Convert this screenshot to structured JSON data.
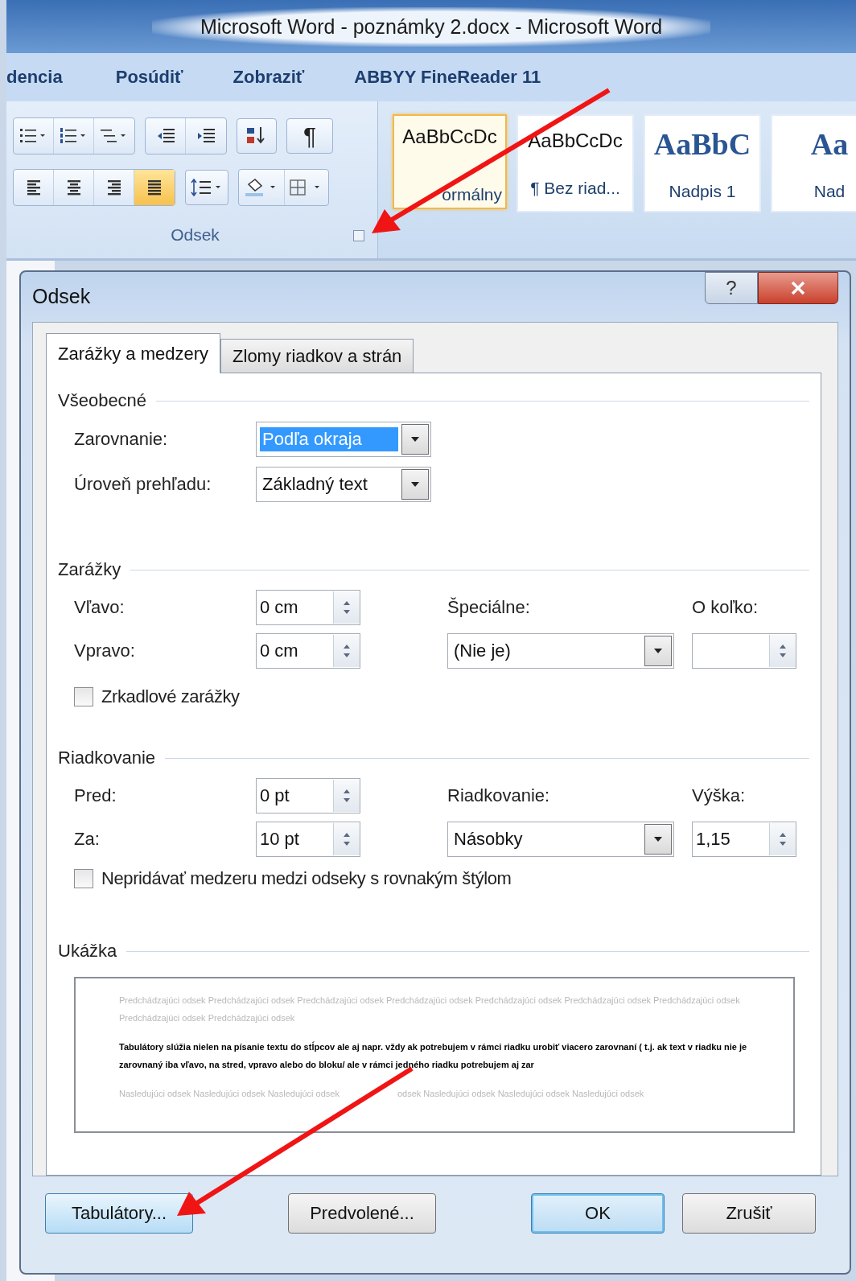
{
  "window": {
    "title": "Microsoft Word - poznámky 2.docx - Microsoft Word"
  },
  "ribbon_tabs": [
    "dencia",
    "Posúdiť",
    "Zobraziť",
    "ABBYY FineReader 11"
  ],
  "paragraph_group": {
    "label": "Odsek",
    "pilcrow": "¶",
    "alignment": [
      {
        "kind": "left",
        "selected": false
      },
      {
        "kind": "center",
        "selected": false
      },
      {
        "kind": "right",
        "selected": false
      },
      {
        "kind": "justify",
        "selected": true
      }
    ]
  },
  "styles": [
    {
      "sample": "AaBbCcDc",
      "name": "ormálny",
      "kind": "normal",
      "selected": true
    },
    {
      "sample": "AaBbCcDc",
      "name": "¶ Bez riad...",
      "kind": "normal",
      "selected": false
    },
    {
      "sample": "AaBbC",
      "name": "Nadpis 1",
      "kind": "heading",
      "selected": false
    },
    {
      "sample": "Aa",
      "name": "Nad",
      "kind": "heading",
      "selected": false
    }
  ],
  "dialog": {
    "title": "Odsek",
    "help": "?",
    "tabs": [
      {
        "label": "Zarážky a medzery",
        "selected": true
      },
      {
        "label": "Zlomy riadkov a strán",
        "selected": false
      }
    ],
    "general": {
      "heading": "Všeobecné",
      "alignment": {
        "label": "Zarovnanie:",
        "value": "Podľa okraja",
        "highlighted": true
      },
      "outline_level": {
        "label": "Úroveň prehľadu:",
        "value": "Základný text",
        "highlighted": false
      }
    },
    "indentation": {
      "heading": "Zarážky",
      "left": {
        "label": "Vľavo:",
        "value": "0 cm"
      },
      "right": {
        "label": "Vpravo:",
        "value": "0 cm"
      },
      "special": {
        "label": "Špeciálne:",
        "value": "(Nie je)"
      },
      "by": {
        "label": "O koľko:"
      },
      "mirror": {
        "label": "Zrkadlové zarážky",
        "checked": false
      }
    },
    "spacing": {
      "heading": "Riadkovanie",
      "before": {
        "label": "Pred:",
        "value": "0 pt"
      },
      "after": {
        "label": "Za:",
        "value": "10 pt"
      },
      "line_spacing": {
        "label": "Riadkovanie:",
        "value": "Násobky"
      },
      "at": {
        "label": "Výška:",
        "value": "1,15"
      },
      "dont_add": {
        "label": "Nepridávať medzeru medzi odseky s rovnakým štýlom",
        "checked": false
      }
    },
    "preview": {
      "heading": "Ukážka",
      "previous": "Predchádzajúci odsek Predchádzajúci odsek Predchádzajúci odsek Predchádzajúci odsek Predchádzajúci odsek Predchádzajúci odsek Predchádzajúci odsek Predchádzajúci odsek Predchádzajúci odsek",
      "current": "Tabulátory slúžia nielen na písanie textu do stĺpcov ale aj napr. vždy ak potrebujem v rámci riadku urobiť viacero zarovnaní ( t.j. ak text v riadku nie je zarovnaný iba vľavo, na stred, vpravo alebo do bloku/ ale v rámci jedného riadku potrebujem aj zar",
      "following": [
        "Nasledujúci odsek Nasledujúci odsek Nasledujúci odsek",
        "odsek Nasledujúci odsek Nasledujúci odsek Nasledujúci odsek"
      ]
    },
    "buttons": [
      {
        "label": "Tabulátory...",
        "kind": "hot"
      },
      {
        "label": "Predvolené...",
        "kind": "normal"
      },
      {
        "label": "OK",
        "kind": "default"
      },
      {
        "label": "Zrušiť",
        "kind": "normal"
      }
    ]
  }
}
